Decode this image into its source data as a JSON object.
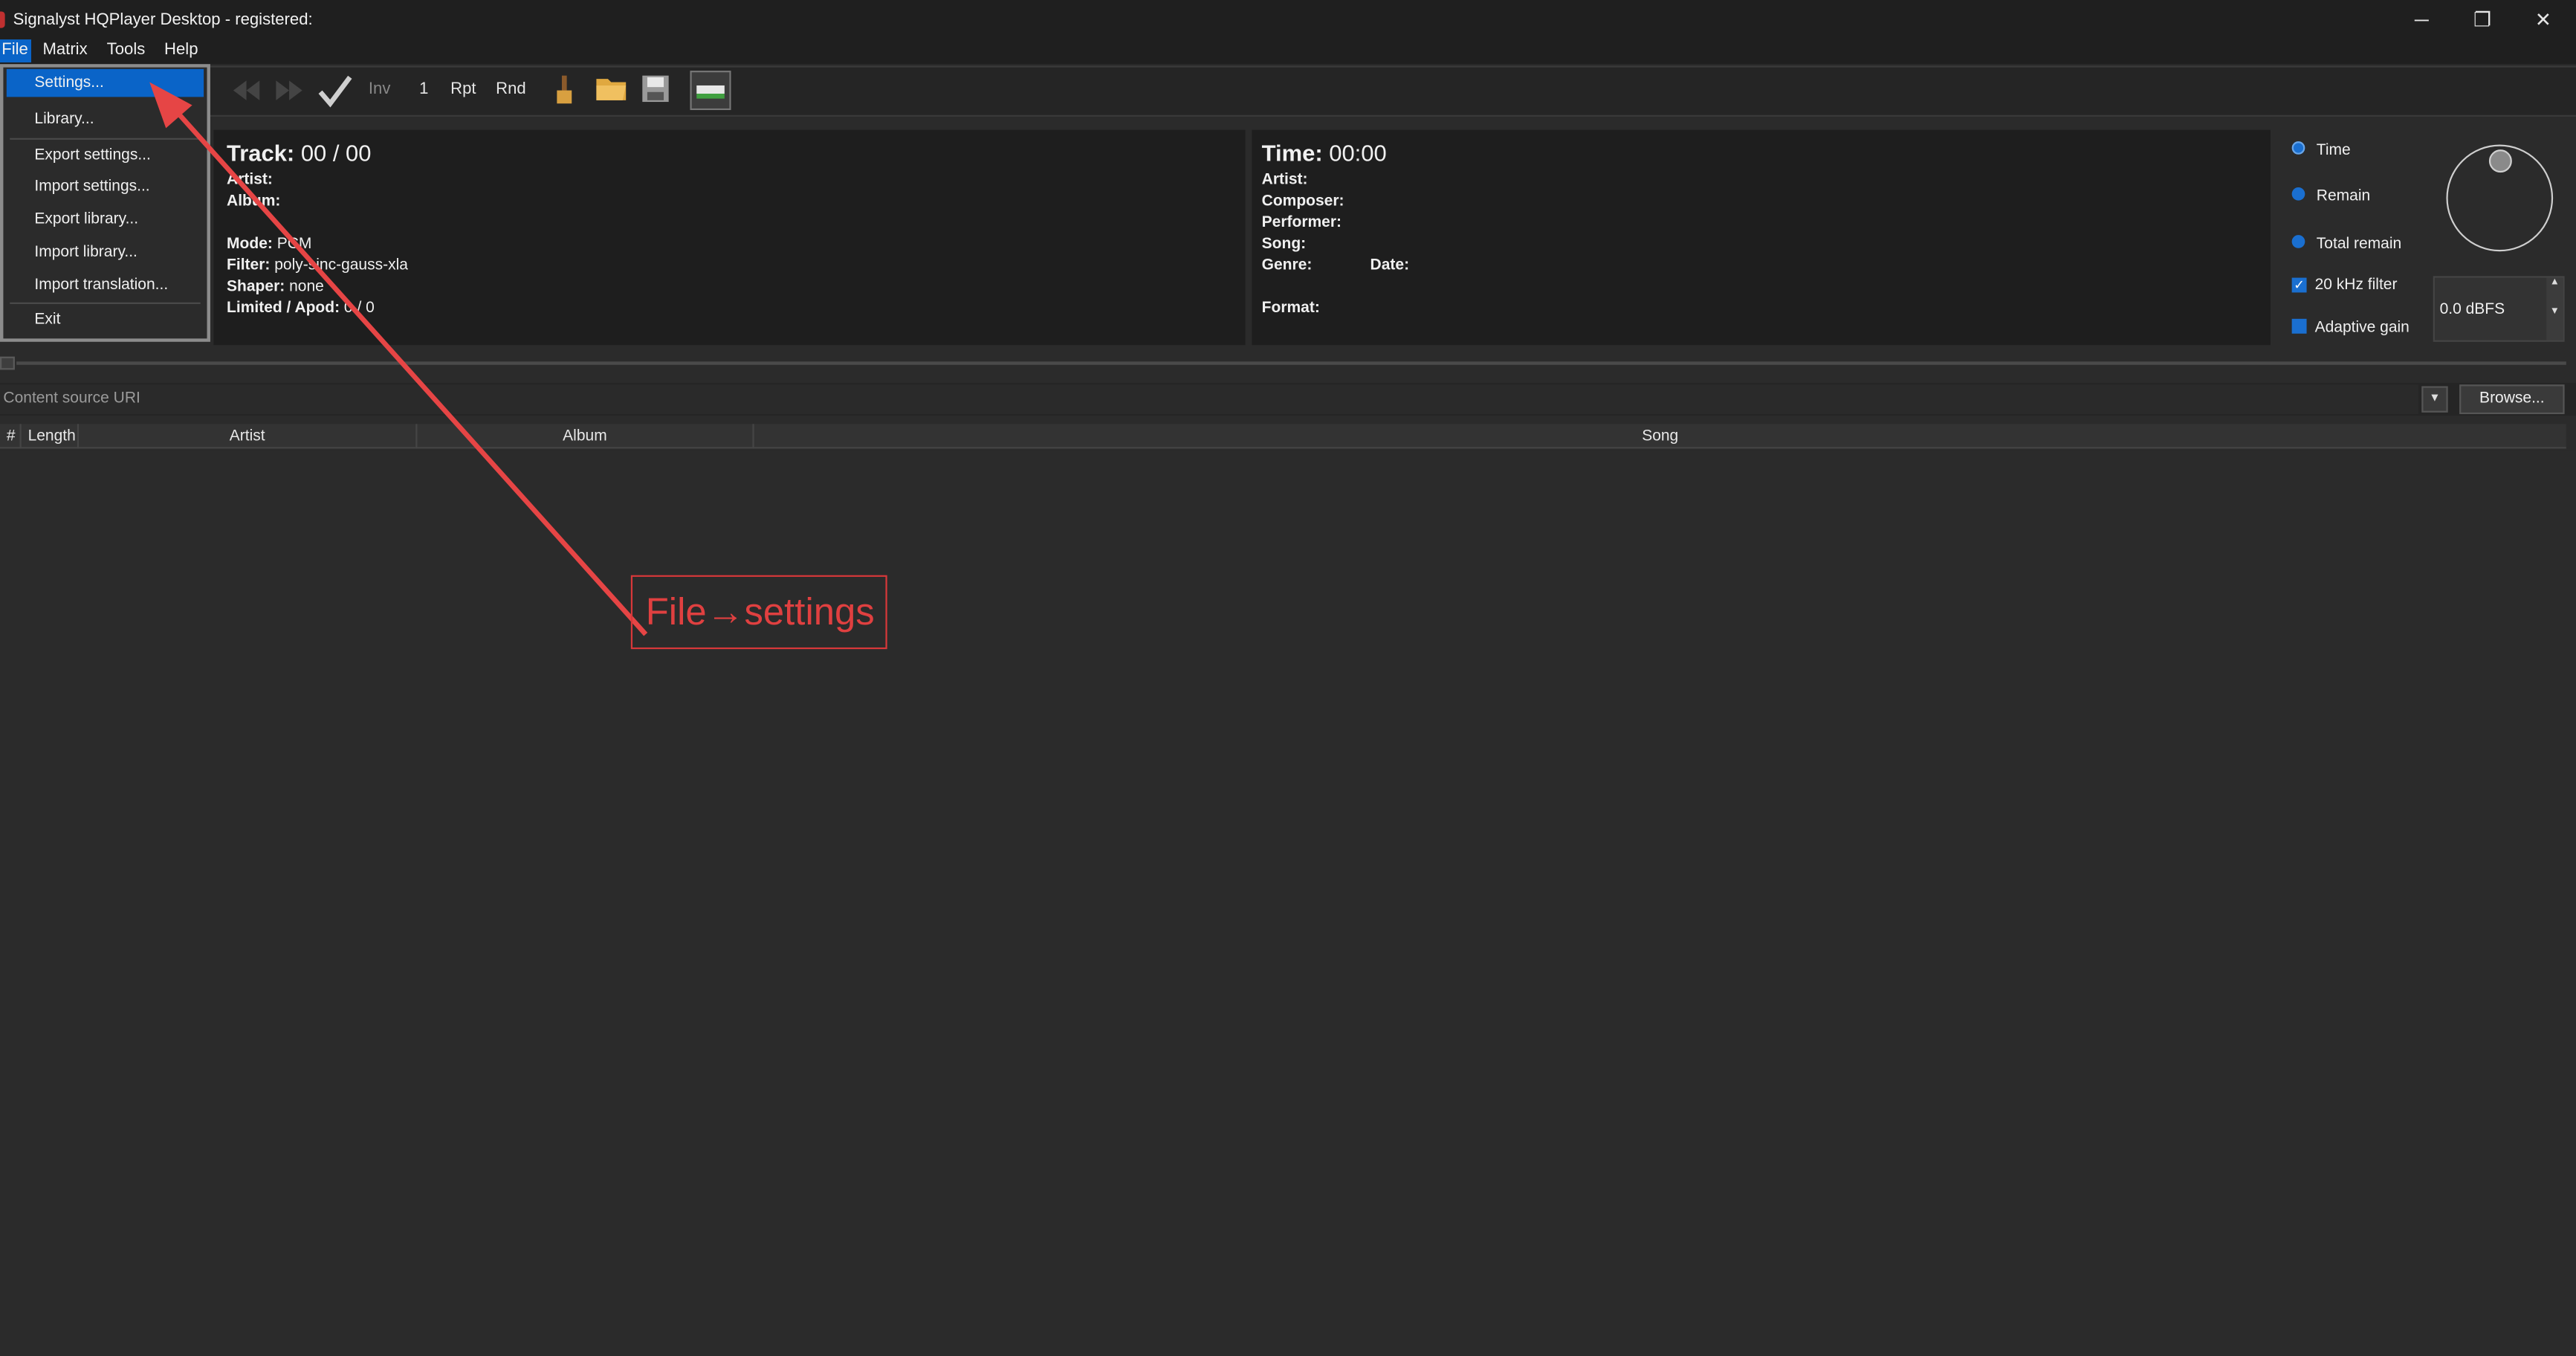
{
  "window": {
    "title": "Signalyst HQPlayer Desktop - registered:",
    "minimize": "─",
    "restore": "❐",
    "close": "✕"
  },
  "menubar": {
    "items": [
      "File",
      "Matrix",
      "Tools",
      "Help"
    ]
  },
  "file_menu": {
    "items": [
      "Settings...",
      "Library...",
      "Export settings...",
      "Import settings...",
      "Export library...",
      "Import library...",
      "Import translation...",
      "Exit"
    ],
    "selected": "Settings..."
  },
  "toolbar": {
    "inv": "Inv",
    "one": "1",
    "rpt": "Rpt",
    "rnd": "Rnd"
  },
  "track_panel": {
    "track_label": "Track:",
    "track_value": "00 / 00",
    "artist_label": "Artist:",
    "album_label": "Album:",
    "mode_label": "Mode:",
    "mode_value": "PCM",
    "filter_label": "Filter:",
    "filter_value": "poly-sinc-gauss-xla",
    "shaper_label": "Shaper:",
    "shaper_value": "none",
    "limited_label": "Limited / Apod:",
    "limited_value": "0 / 0"
  },
  "time_panel": {
    "time_label": "Time:",
    "time_value": "00:00",
    "artist_label": "Artist:",
    "composer_label": "Composer:",
    "performer_label": "Performer:",
    "song_label": "Song:",
    "genre_label": "Genre:",
    "date_label": "Date:",
    "format_label": "Format:"
  },
  "right_panel": {
    "time": "Time",
    "remain": "Remain",
    "total_remain": "Total remain",
    "filter_20khz": "20 kHz filter",
    "adaptive_gain": "Adaptive gain",
    "volume": "0.0 dBFS",
    "selected_display": "Time",
    "filter_20khz_checked": true,
    "adaptive_gain_checked": false
  },
  "source": {
    "placeholder": "Content source URI",
    "browse": "Browse..."
  },
  "table": {
    "columns": [
      "#",
      "Length",
      "Artist",
      "Album",
      "Song"
    ]
  },
  "annotation": {
    "text": "File→settings",
    "color": "#e04040"
  },
  "colors": {
    "accent": "#0a64c8",
    "background": "#2b2b2b",
    "panel": "#1e1e1e"
  }
}
